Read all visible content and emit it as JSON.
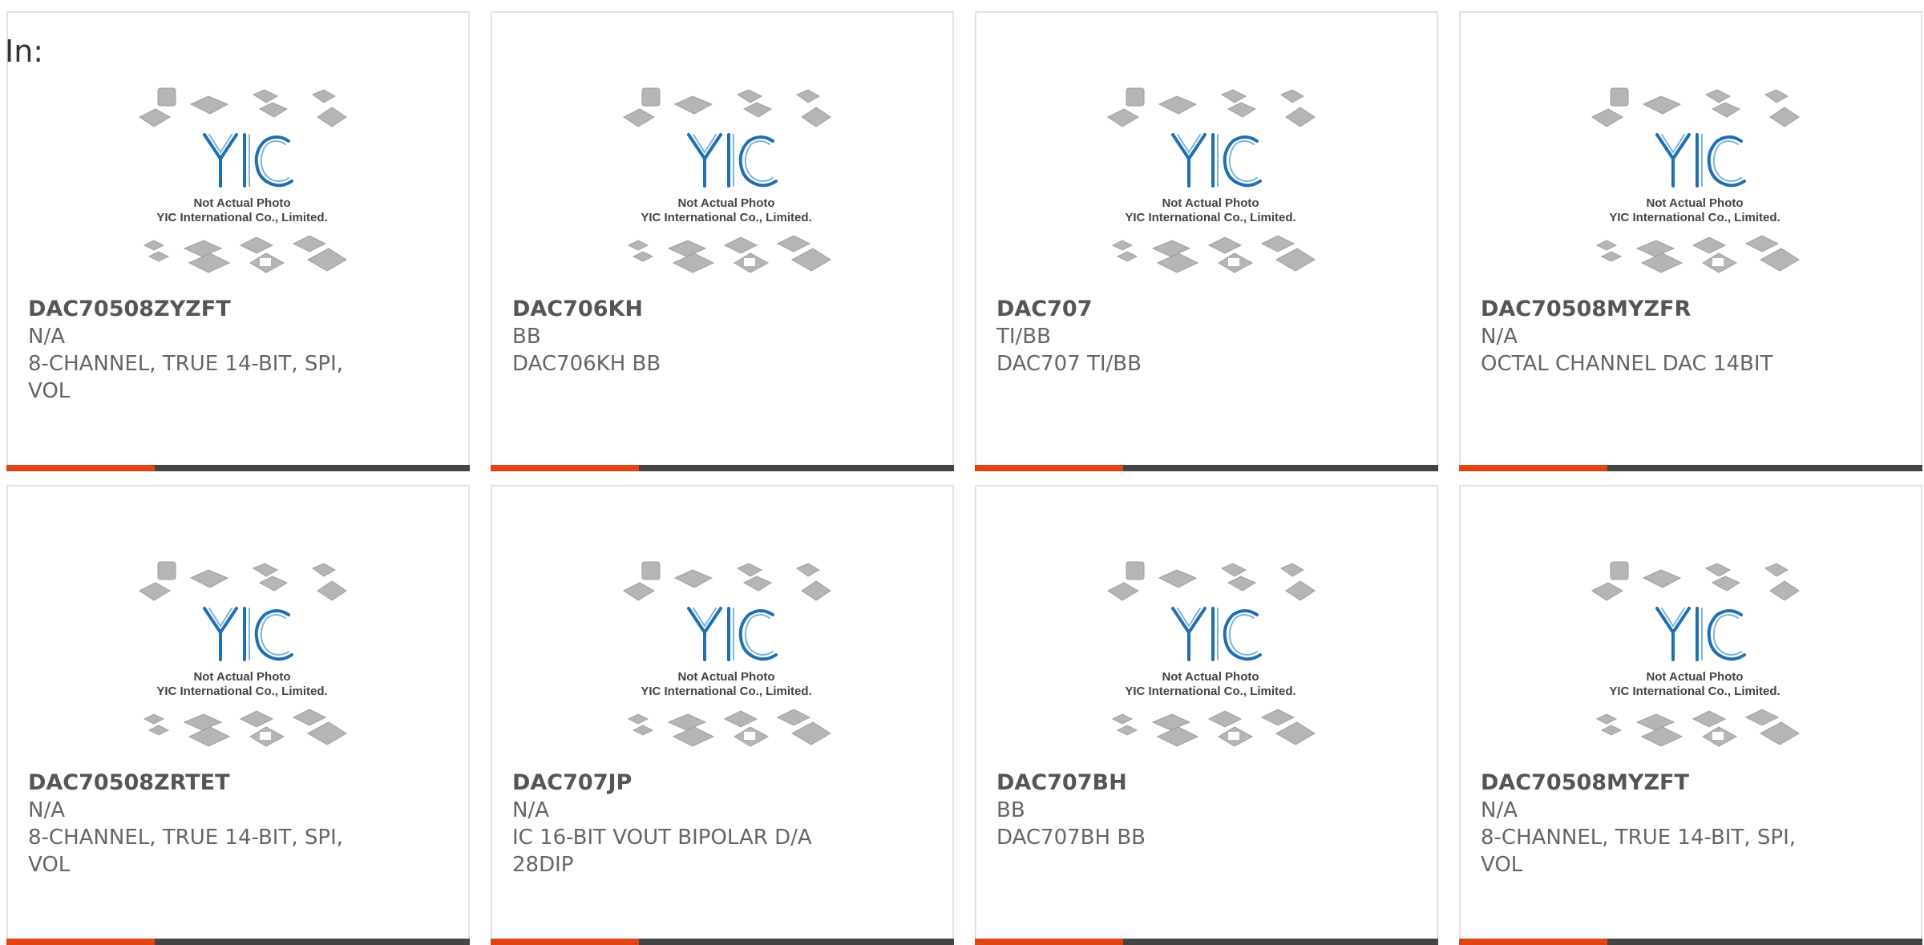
{
  "header": {
    "in_label": "In:"
  },
  "colors": {
    "accent": "#e04413",
    "dark": "#444444",
    "logo_blue": "#1f6fb2",
    "chip_gray": "#b5b5b5"
  },
  "placeholder": {
    "line1": "Not Actual Photo",
    "line2": "YIC International Co., Limited.",
    "logo_text": "YIC"
  },
  "products": [
    {
      "part": "DAC70508ZYZFT",
      "brand": "N/A",
      "desc": "8-CHANNEL, TRUE 14-BIT, SPI, VOL"
    },
    {
      "part": "DAC706KH",
      "brand": "BB",
      "desc": "DAC706KH BB"
    },
    {
      "part": "DAC707",
      "brand": "TI/BB",
      "desc": "DAC707 TI/BB"
    },
    {
      "part": "DAC70508MYZFR",
      "brand": "N/A",
      "desc": "OCTAL CHANNEL DAC 14BIT"
    },
    {
      "part": "DAC70508ZRTET",
      "brand": "N/A",
      "desc": "8-CHANNEL, TRUE 14-BIT, SPI, VOL"
    },
    {
      "part": "DAC707JP",
      "brand": "N/A",
      "desc": "IC 16-BIT VOUT BIPOLAR D/A 28DIP"
    },
    {
      "part": "DAC707BH",
      "brand": "BB",
      "desc": "DAC707BH BB"
    },
    {
      "part": "DAC70508MYZFT",
      "brand": "N/A",
      "desc": "8-CHANNEL, TRUE 14-BIT, SPI, VOL"
    }
  ]
}
